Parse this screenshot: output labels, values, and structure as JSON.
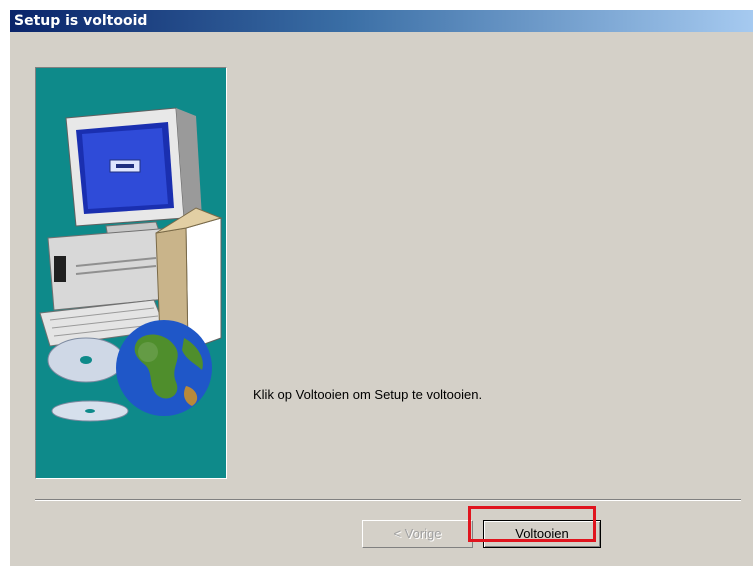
{
  "window": {
    "title": "Setup is voltooid"
  },
  "content": {
    "message": "Klik op Voltooien om Setup te voltooien."
  },
  "buttons": {
    "back_label": "< Vorige",
    "finish_label": "Voltooien"
  },
  "colors": {
    "titlebar_start": "#0a246a",
    "titlebar_end": "#a6caf0",
    "dialog_bg": "#d4d0c8",
    "side_panel": "#0e8a8a",
    "highlight": "#e0141e"
  },
  "icons": {
    "side_image": "computer-cd-globe-illustration"
  }
}
